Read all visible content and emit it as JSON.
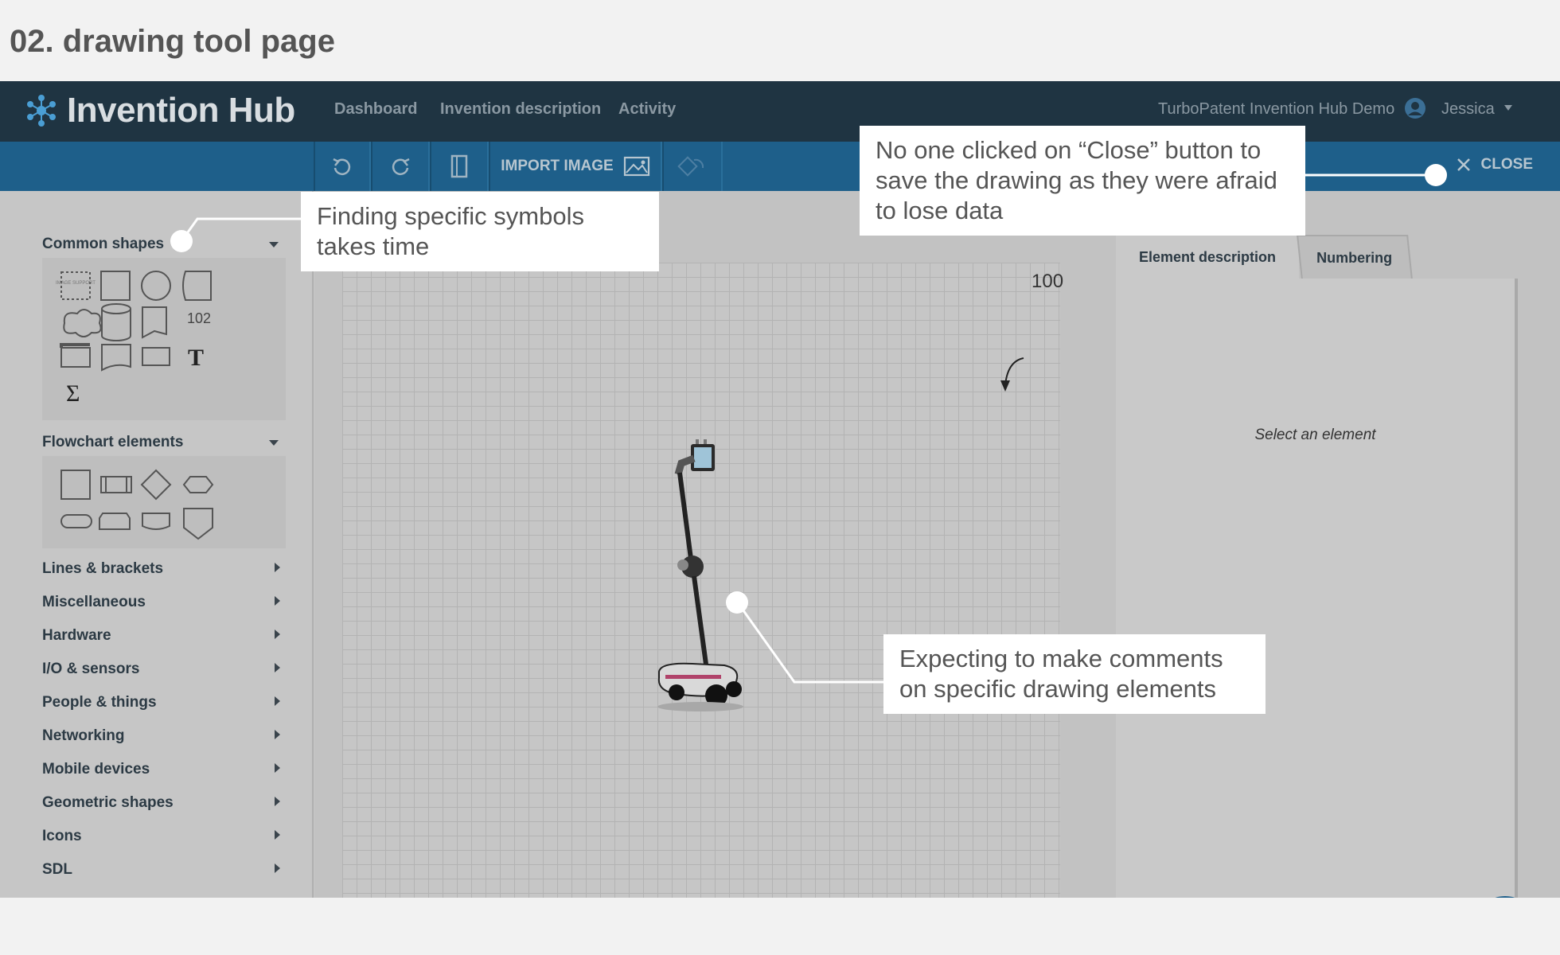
{
  "slide": {
    "title": "02. drawing tool page"
  },
  "topnav": {
    "logo": "Invention Hub",
    "links": [
      "Dashboard",
      "Invention description",
      "Activity"
    ],
    "demo_label": "TurboPatent Invention Hub Demo",
    "user": "Jessica"
  },
  "toolbar": {
    "import_label": "IMPORT IMAGE",
    "close_label": "CLOSE"
  },
  "sidebar": {
    "common_shapes": "Common shapes",
    "common_shapes_items": {
      "image_mini": "IMAGE SUPPORT",
      "num_label": "102",
      "text_tool": "T",
      "sigma": "Σ"
    },
    "flowchart": "Flowchart elements",
    "categories": [
      "Lines & brackets",
      "Miscellaneous",
      "Hardware",
      "I/O & sensors",
      "People & things",
      "Networking",
      "Mobile devices",
      "Geometric shapes",
      "Icons",
      "SDL"
    ]
  },
  "canvas": {
    "reference_number": "100"
  },
  "right_panel": {
    "tabs": [
      "Element description",
      "Numbering"
    ],
    "placeholder": "Select an element"
  },
  "callouts": {
    "symbols": "Finding specific symbols takes time",
    "close": "No one clicked on “Close” button to save the drawing as they were afraid to lose data",
    "comments": "Expecting to make comments on specific drawing elements"
  },
  "colors": {
    "nav": "#1f3442",
    "toolbar": "#1e5f8a",
    "callout": "#ffffff"
  }
}
